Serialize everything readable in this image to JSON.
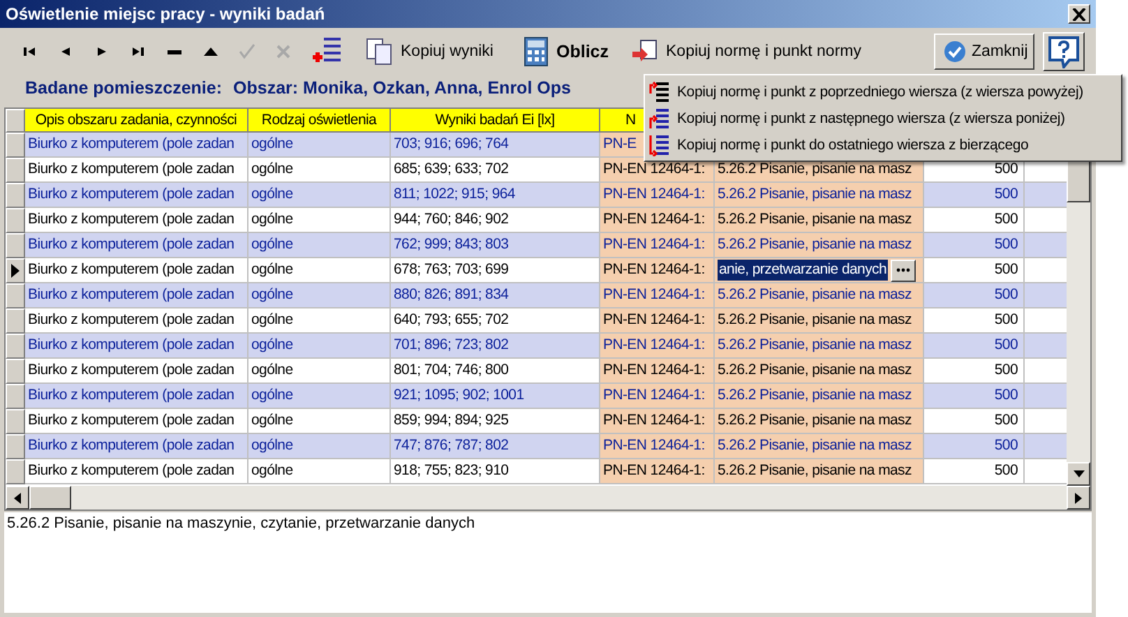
{
  "window": {
    "title": "Oświetlenie miejsc pracy - wyniki badań"
  },
  "toolbar": {
    "nav": [
      {
        "kind": "first",
        "disabled": false
      },
      {
        "kind": "prev",
        "disabled": false
      },
      {
        "kind": "next",
        "disabled": false
      },
      {
        "kind": "last",
        "disabled": false
      },
      {
        "kind": "delete",
        "disabled": false
      },
      {
        "kind": "up",
        "disabled": false
      },
      {
        "kind": "confirm",
        "disabled": true
      },
      {
        "kind": "cancel",
        "disabled": true
      },
      {
        "kind": "add",
        "disabled": false
      }
    ],
    "copy_results": "Kopiuj wyniki",
    "calculate": "Oblicz",
    "copy_norm": "Kopiuj normę i punkt normy",
    "close": "Zamknij"
  },
  "room": {
    "label": "Badane pomieszczenie:",
    "value": "Obszar: Monika, Ozkan, Anna, Enrol Ops"
  },
  "menu": {
    "items": [
      {
        "kind": "from-prev",
        "label": "Kopiuj normę i punkt z poprzedniego wiersza (z wiersza powyżej)"
      },
      {
        "kind": "from-next",
        "label": "Kopiuj normę i punkt z następnego wiersza (z wiersza poniżej)"
      },
      {
        "kind": "to-last",
        "label": "Kopiuj normę i punkt do ostatniego wiersza z bierzącego"
      }
    ]
  },
  "table": {
    "columns": [
      "Opis obszaru zadania, czynności",
      "Rodzaj oświetlenia",
      "Wyniki badań Ei [lx]",
      "N"
    ],
    "rows": [
      {
        "selected": false,
        "cells": [
          "Biurko z komputerem (pole zadan",
          "ogólne",
          "703; 916; 696; 764",
          "PN-E"
        ]
      },
      {
        "selected": false,
        "cells": [
          "Biurko z komputerem (pole zadan",
          "ogólne",
          "685; 639; 633; 702",
          "PN-EN 12464-1:",
          "5.26.2 Pisanie, pisanie na masz",
          "500"
        ]
      },
      {
        "selected": false,
        "cells": [
          "Biurko z komputerem (pole zadan",
          "ogólne",
          "811; 1022; 915; 964",
          "PN-EN 12464-1:",
          "5.26.2 Pisanie, pisanie na masz",
          "500"
        ]
      },
      {
        "selected": false,
        "cells": [
          "Biurko z komputerem (pole zadan",
          "ogólne",
          "944; 760; 846; 902",
          "PN-EN 12464-1:",
          "5.26.2 Pisanie, pisanie na masz",
          "500"
        ]
      },
      {
        "selected": false,
        "cells": [
          "Biurko z komputerem (pole zadan",
          "ogólne",
          "762; 999; 843; 803",
          "PN-EN 12464-1:",
          "5.26.2 Pisanie, pisanie na masz",
          "500"
        ]
      },
      {
        "selected": true,
        "cells": [
          "Biurko z komputerem (pole zadan",
          "ogólne",
          "678; 763; 703; 699",
          "PN-EN 12464-1:",
          "anie, przetwarzanie danych",
          "500"
        ]
      },
      {
        "selected": false,
        "cells": [
          "Biurko z komputerem (pole zadan",
          "ogólne",
          "880; 826; 891; 834",
          "PN-EN 12464-1:",
          "5.26.2 Pisanie, pisanie na masz",
          "500"
        ]
      },
      {
        "selected": false,
        "cells": [
          "Biurko z komputerem (pole zadan",
          "ogólne",
          "640; 793; 655; 702",
          "PN-EN 12464-1:",
          "5.26.2 Pisanie, pisanie na masz",
          "500"
        ]
      },
      {
        "selected": false,
        "cells": [
          "Biurko z komputerem (pole zadan",
          "ogólne",
          "701;  896; 723; 802",
          "PN-EN 12464-1:",
          "5.26.2 Pisanie, pisanie na masz",
          "500"
        ]
      },
      {
        "selected": false,
        "cells": [
          "Biurko z komputerem (pole zadan",
          "ogólne",
          "801; 704; 746; 800",
          "PN-EN 12464-1:",
          "5.26.2 Pisanie, pisanie na masz",
          "500"
        ]
      },
      {
        "selected": false,
        "cells": [
          "Biurko z komputerem (pole zadan",
          "ogólne",
          "921; 1095; 902; 1001",
          "PN-EN 12464-1:",
          "5.26.2 Pisanie, pisanie na masz",
          "500"
        ]
      },
      {
        "selected": false,
        "cells": [
          "Biurko z komputerem (pole zadan",
          "ogólne",
          "859; 994; 894; 925",
          "PN-EN 12464-1:",
          "5.26.2 Pisanie, pisanie na masz",
          "500"
        ]
      },
      {
        "selected": false,
        "cells": [
          "Biurko z komputerem (pole zadan",
          "ogólne",
          "747; 876; 787; 802",
          "PN-EN 12464-1:",
          "5.26.2 Pisanie, pisanie na masz",
          "500"
        ]
      },
      {
        "selected": false,
        "cells": [
          "Biurko z komputerem (pole zadan",
          "ogólne",
          "918; 755; 823; 910",
          "PN-EN 12464-1:",
          "5.26.2 Pisanie, pisanie na masz",
          "500"
        ]
      }
    ]
  },
  "status_text": "5.26.2 Pisanie, pisanie na maszynie, czytanie, przetwarzanie danych"
}
